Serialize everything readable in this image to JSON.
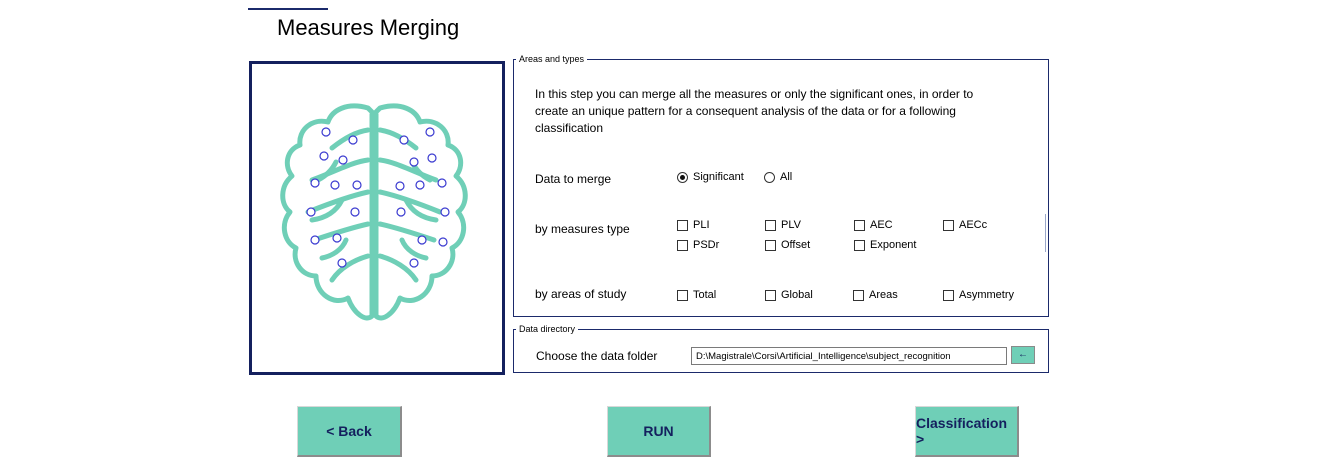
{
  "page_title": "Measures Merging",
  "areas_group": {
    "legend": "Areas and types",
    "description": "In this step you can merge all the measures or only the significant ones, in order to create an unique pattern for a consequent analysis of the data or for a following classification",
    "data_to_merge": {
      "label": "Data to merge",
      "options": [
        {
          "label": "Significant",
          "selected": true
        },
        {
          "label": "All",
          "selected": false
        }
      ]
    },
    "by_measures_type": {
      "label": "by measures type",
      "options": [
        "PLI",
        "PLV",
        "AEC",
        "AECc",
        "PSDr",
        "Offset",
        "Exponent"
      ]
    },
    "by_areas_of_study": {
      "label": "by areas of study",
      "options": [
        "Total",
        "Global",
        "Areas",
        "Asymmetry"
      ]
    }
  },
  "data_directory": {
    "legend": "Data directory",
    "label": "Choose the data folder",
    "path": "D:\\Magistrale\\Corsi\\Artificial_Intelligence\\subject_recognition",
    "browse_label": "←"
  },
  "buttons": {
    "back": "<  Back",
    "run": "RUN",
    "classification": "Classification >"
  },
  "colors": {
    "accent_button": "#6fcfb7",
    "frame_navy": "#14205e",
    "brain_outline": "#6fcfb7"
  },
  "icons": {
    "brain": "brain-illustration"
  }
}
